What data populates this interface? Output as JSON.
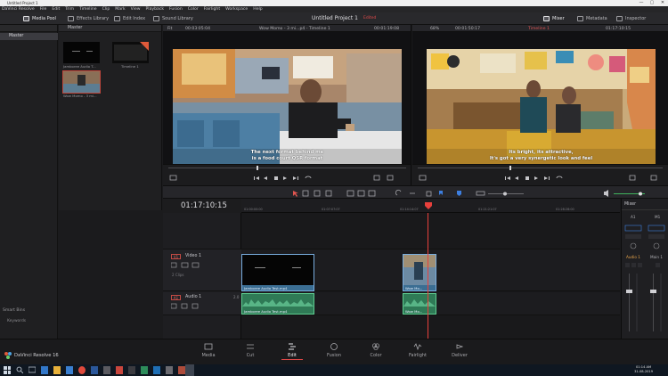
{
  "window": {
    "title": "Untitled Project 1",
    "controls": [
      "—",
      "▢",
      "✕"
    ]
  },
  "menu": [
    "DaVinci Resolve",
    "File",
    "Edit",
    "Trim",
    "Timeline",
    "Clip",
    "Mark",
    "View",
    "Playback",
    "Fusion",
    "Color",
    "Fairlight",
    "Workspace",
    "Help"
  ],
  "toolbar": {
    "media_pool": "Media Pool",
    "effects_library": "Effects Library",
    "edit_index": "Edit Index",
    "sound_library": "Sound Library",
    "project_title": "Untitled Project 1",
    "project_status": "Edited",
    "mixer": "Mixer",
    "metadata": "Metadata",
    "inspector": "Inspector"
  },
  "media_pool": {
    "bin_name": "Master",
    "master_item": "Master",
    "smart_bins": "Smart Bins",
    "keywords": "Keywords",
    "clips": [
      {
        "label": "Jamboree Audio T...",
        "kind": "video"
      },
      {
        "label": "Timeline 1",
        "kind": "timeline"
      },
      {
        "label": "Wow Momo - 3 mi...",
        "kind": "video"
      }
    ]
  },
  "source_viewer": {
    "zoom": "Fit",
    "timecode_in": "00:03:05:04",
    "clip_name": "Wow Momo - 3 mi...p4 - Timeline 1",
    "timecode_out": "00:01:19:08",
    "subtitle_line1": "The next format behind me",
    "subtitle_line2": "is a food court QSR format"
  },
  "timeline_viewer": {
    "zoom": "68%",
    "duration": "00:01:50:17",
    "timeline_name": "Timeline 1",
    "timecode": "01:17:10:15",
    "subtitle_line1": "Its bright, its attractive,",
    "subtitle_line2": "It's got a very synergetic look and feel"
  },
  "timeline": {
    "timecode": "01:17:10:15",
    "ruler_ticks": [
      "01:00:00:00",
      "01:07:07:07",
      "01:14:14:07",
      "01:21:21:07",
      "01:28:28:00"
    ],
    "video_track": {
      "tag": "V1",
      "name": "Video 1",
      "clip_count": "2 Clips"
    },
    "audio_track": {
      "tag": "A1",
      "name": "Audio 1",
      "level": "2.0"
    },
    "clips": {
      "v1_a": "Jamboree Audio Test.mp4",
      "v1_b": "Wow Mo...",
      "a1_a": "Jamboree Audio Test.mp4",
      "a1_b": "Wow Mo..."
    }
  },
  "mixer": {
    "title": "Mixer",
    "ch1": "A1",
    "ch2": "M1",
    "ch1_label": "Audio 1",
    "ch2_label": "Main 1"
  },
  "pages": [
    "Media",
    "Cut",
    "Edit",
    "Fusion",
    "Color",
    "Fairlight",
    "Deliver"
  ],
  "active_page": "Edit",
  "brand": "DaVinci Resolve 16",
  "clock": {
    "time": "01:14 AM",
    "date": "31-08-2019"
  },
  "colors": {
    "accent_red": "#e04848",
    "video_clip": "#3b6e93",
    "audio_clip": "#2f7a56",
    "playhead": "#e8403c"
  }
}
